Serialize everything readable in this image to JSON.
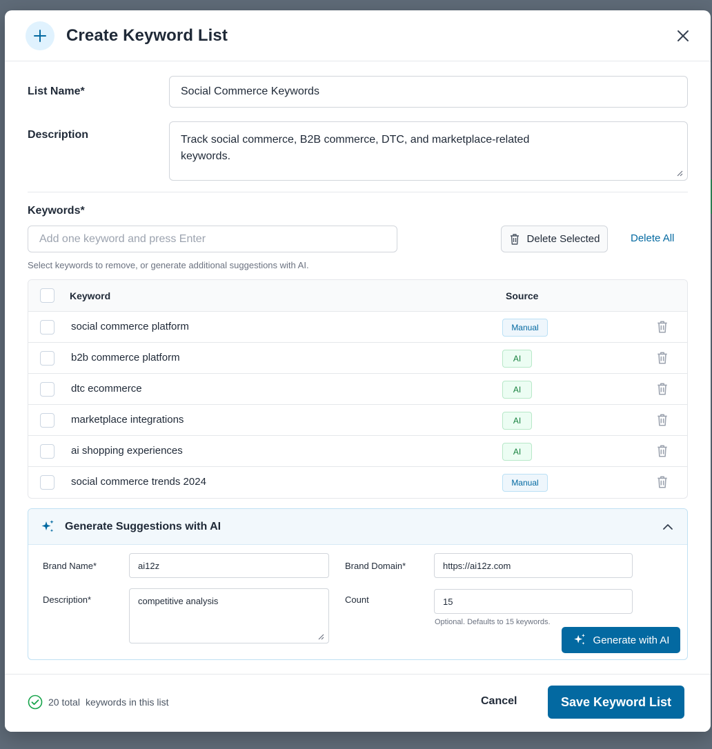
{
  "dialog": {
    "title": "Create Keyword List",
    "header_icon": "plus-icon",
    "close_icon": "close-icon"
  },
  "form": {
    "list_name_label": "List Name*",
    "list_name_value": "Social Commerce Keywords",
    "description_label": "Description",
    "description_value": "Track social commerce, B2B commerce, DTC, and marketplace-related keywords.",
    "keywords_label": "Keywords*",
    "keyword_input_placeholder": "Add one keyword and press Enter",
    "delete_selected_label": "Delete Selected",
    "delete_all_label": "Delete All",
    "hint": "Select keywords to remove, or generate additional suggestions with AI."
  },
  "table": {
    "headers": {
      "keyword": "Keyword",
      "source": "Source"
    },
    "rows": [
      {
        "keyword": "social commerce platform",
        "source": "Manual"
      },
      {
        "keyword": "b2b commerce platform",
        "source": "AI"
      },
      {
        "keyword": "dtc ecommerce",
        "source": "AI"
      },
      {
        "keyword": "marketplace integrations",
        "source": "AI"
      },
      {
        "keyword": "ai shopping experiences",
        "source": "AI"
      },
      {
        "keyword": "social commerce trends 2024",
        "source": "Manual"
      }
    ]
  },
  "ai_panel": {
    "title": "Generate Suggestions with AI",
    "expanded": true,
    "brand_name_label": "Brand Name*",
    "brand_name_value": "ai12z",
    "brand_domain_label": "Brand Domain*",
    "brand_domain_value": "https://ai12z.com",
    "description_label": "Description*",
    "description_value": "competitive analysis",
    "count_label": "Count",
    "count_value": "15",
    "count_hint": "Optional. Defaults to 15 keywords.",
    "generate_label": "Generate with AI"
  },
  "footer": {
    "total_count": "20 total",
    "total_suffix": "keywords in this list",
    "cancel_label": "Cancel",
    "save_label": "Save Keyword List"
  },
  "colors": {
    "primary": "#0369a1",
    "ai_badge": "#15803d",
    "manual_badge": "#0369a1",
    "success": "#16a34a"
  }
}
